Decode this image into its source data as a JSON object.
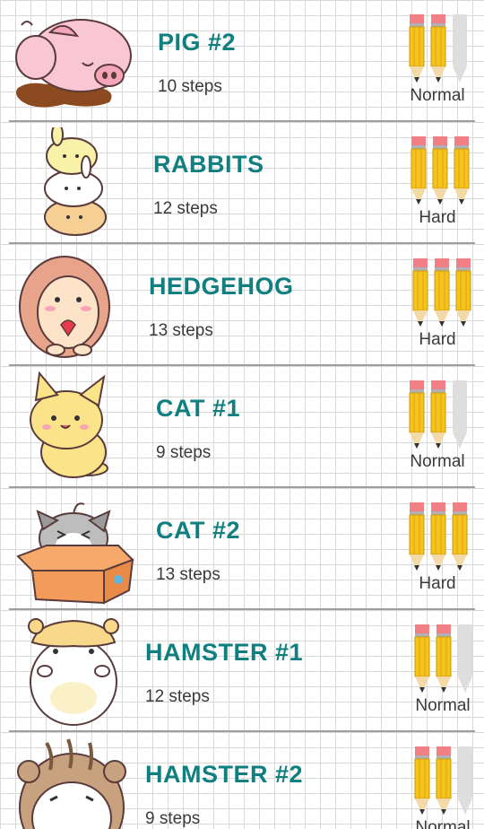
{
  "drawings": [
    {
      "name": "PIG #2",
      "steps": "10 steps",
      "difficulty": "Normal",
      "level": 2,
      "max_level": 3,
      "thumb_icon": "pig-icon"
    },
    {
      "name": "RABBITS",
      "steps": "12 steps",
      "difficulty": "Hard",
      "level": 3,
      "max_level": 3,
      "thumb_icon": "rabbits-icon"
    },
    {
      "name": "HEDGEHOG",
      "steps": "13 steps",
      "difficulty": "Hard",
      "level": 3,
      "max_level": 3,
      "thumb_icon": "hedgehog-icon"
    },
    {
      "name": "CAT #1",
      "steps": "9 steps",
      "difficulty": "Normal",
      "level": 2,
      "max_level": 3,
      "thumb_icon": "cat-icon"
    },
    {
      "name": "CAT #2",
      "steps": "13 steps",
      "difficulty": "Hard",
      "level": 3,
      "max_level": 3,
      "thumb_icon": "cat-in-box-icon"
    },
    {
      "name": "HAMSTER #1",
      "steps": "12 steps",
      "difficulty": "Normal",
      "level": 2,
      "max_level": 3,
      "thumb_icon": "hamster-icon"
    },
    {
      "name": "HAMSTER #2",
      "steps": "9 steps",
      "difficulty": "Normal",
      "level": 2,
      "max_level": 3,
      "thumb_icon": "hamster-icon"
    }
  ],
  "colors": {
    "title": "#0f7f80",
    "pencil_body": "#f6c21c",
    "pencil_eraser": "#f07f86",
    "pencil_inactive": "#dedede",
    "divider": "#9e9e9e"
  }
}
